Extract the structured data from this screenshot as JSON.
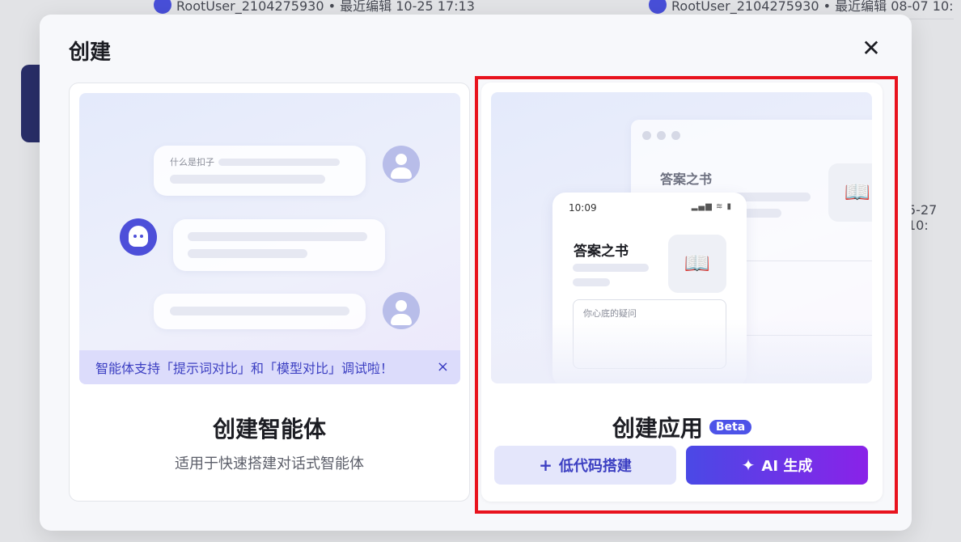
{
  "background": {
    "row1_left": "RootUser_2104275930 • 最近编辑 10-25 17:13",
    "row1_right": "RootUser_2104275930 • 最近编辑 08-07 10:",
    "side_text": "5-27 10:"
  },
  "modal": {
    "title": "创建",
    "close_icon": "close-icon"
  },
  "agent_card": {
    "preview": {
      "question": "什么是扣子",
      "tip": "智能体支持「提示词对比」和「模型对比」调试啦！",
      "tip_close": "×"
    },
    "title": "创建智能体",
    "subtitle": "适用于快速搭建对话式智能体"
  },
  "app_card": {
    "preview": {
      "window_title": "答案之书",
      "phone_time": "10:09",
      "phone_status": "▂▄▆ ≋ ▮",
      "phone_title": "答案之书",
      "book_glyph": "📖",
      "input_placeholder": "你心底的疑问"
    },
    "title": "创建应用",
    "badge": "Beta",
    "buttons": {
      "lowcode_icon": "+",
      "lowcode_label": "低代码搭建",
      "ai_icon": "✦",
      "ai_label": "AI 生成"
    }
  },
  "colors": {
    "accent": "#4d53e8",
    "highlight": "#e8131e"
  }
}
